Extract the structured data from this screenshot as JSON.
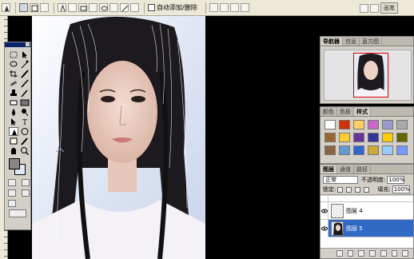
{
  "options_bar": {
    "auto_add_delete": "自动添加/删除",
    "brushes_tab": "画笔"
  },
  "toolbox": {
    "foreground_color": "#8a8583",
    "background_color": "#dfe8f8"
  },
  "navigator": {
    "tabs": [
      "导航器",
      "信息",
      "直方图"
    ]
  },
  "swatches": {
    "tabs": [
      "颜色",
      "色板",
      "样式"
    ],
    "styles": [
      "#ffffff",
      "#cc3300",
      "#ffcc66",
      "#cc66cc",
      "#9999cc",
      "#aaaaaa",
      "#996633",
      "#ffcc33",
      "#663399",
      "#333399",
      "#ffcc00",
      "#666600",
      "#886644",
      "#6699cc",
      "#3366cc",
      "#ccaa33",
      "#99ccff",
      "#7799ff"
    ]
  },
  "layers": {
    "tabs": [
      "图层",
      "通道",
      "路径"
    ],
    "blend_mode": "正常",
    "opacity_label": "不透明度:",
    "opacity": "100%",
    "lock_label": "锁定:",
    "fill_label": "填充:",
    "fill": "100%",
    "items": [
      {
        "name": ""
      },
      {
        "name": "图层 4"
      },
      {
        "name": "图层 5"
      }
    ]
  },
  "colors": {
    "selection": "#316ac5",
    "accent_red": "#e00000"
  }
}
